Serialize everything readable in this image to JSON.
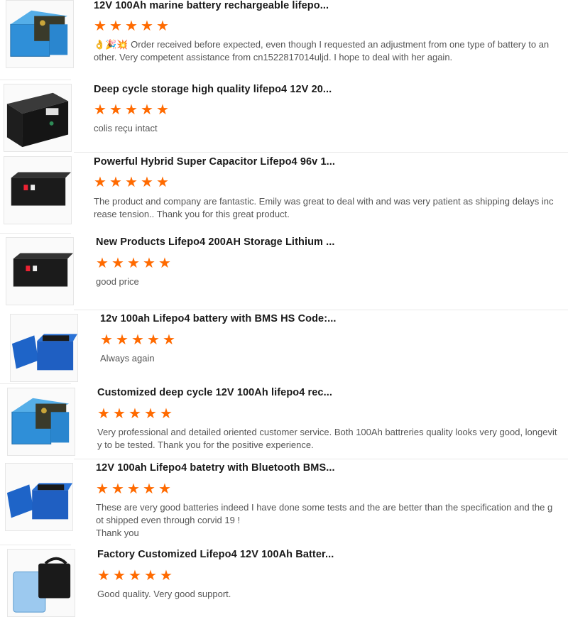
{
  "star_color": "#ff6a00",
  "reviews": [
    {
      "title": "12V 100Ah marine battery rechargeable lifepo...",
      "stars": 5,
      "emoji": "👌🎉💥",
      "text": " Order received before expected, even though I requested an adjustment from one type of battery to another. Very competent assistance from cn1522817014uljd. I hope to deal with her again.",
      "image": "blue-battery-open-icon"
    },
    {
      "title": "Deep cycle storage high quality lifepo4 12V 20...",
      "stars": 5,
      "text": "colis reçu intact",
      "image": "black-battery-icon"
    },
    {
      "title": "Powerful Hybrid Super Capacitor Lifepo4 96v 1...",
      "stars": 5,
      "text": "The product and company are fantastic.    Emily was great to deal with and was very patient as shipping delays increase tension..  Thank you for this great product.",
      "image": "black-battery-box-icon"
    },
    {
      "title": "New Products Lifepo4 200AH Storage Lithium ...",
      "stars": 5,
      "text": "good price",
      "image": "black-battery-box-icon"
    },
    {
      "title": "12v 100ah Lifepo4 battery with BMS HS Code:...",
      "stars": 5,
      "text": "Always again",
      "image": "blue-battery-lid-icon"
    },
    {
      "title": "Customized deep cycle 12V 100Ah lifepo4 rec...",
      "stars": 5,
      "text": "Very professional and detailed oriented customer service. Both 100Ah battreries quality looks very good, longevity to be tested. Thank you for the positive experience.",
      "image": "blue-battery-open-icon"
    },
    {
      "title": "12V 100ah Lifepo4 batetry with Bluetooth BMS...",
      "stars": 5,
      "text": "These are very good batteries indeed I have done some tests and the are better than the specification and the got shipped even through corvid 19 !\nThank you",
      "image": "blue-battery-lid-icon"
    },
    {
      "title": "Factory Customized Lifepo4 12V 100Ah Batter...",
      "stars": 5,
      "text": "Good quality.  Very good support.",
      "image": "twin-battery-icon"
    }
  ]
}
